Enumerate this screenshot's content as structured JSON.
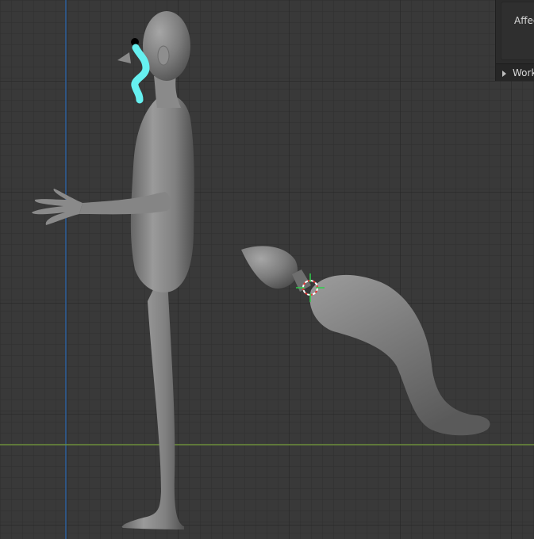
{
  "sidebar_panel": {
    "affect_label": "Affect",
    "workspace_row_label": "Works"
  },
  "icons": {
    "expand": "triangle-right-icon",
    "cursor": "3d-cursor-icon"
  },
  "colors": {
    "viewport_bg": "#393939",
    "grid_minor": "#333333",
    "grid_major": "#2c2c2c",
    "axis_x": "#6f8f3c",
    "axis_y": "#2d5f9a",
    "mesh": "#7b7b7b",
    "stroke_cyan": "#66f0f0"
  }
}
